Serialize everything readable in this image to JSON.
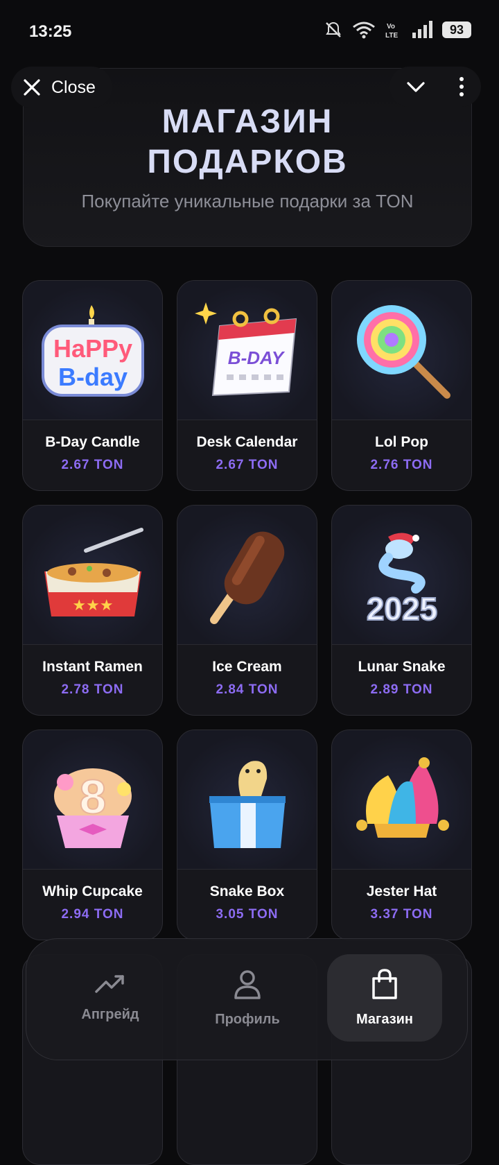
{
  "status_bar": {
    "time": "13:25",
    "battery": "93"
  },
  "top_bar": {
    "close_label": "Close"
  },
  "hero": {
    "title_line1": "МАГАЗИН",
    "title_line2": "ПОДАРКОВ",
    "subtitle": "Покупайте уникальные подарки за TON"
  },
  "gifts": [
    {
      "name": "B-Day Candle",
      "price": "2.67 TON",
      "icon": "birthday-candle-icon"
    },
    {
      "name": "Desk Calendar",
      "price": "2.67 TON",
      "icon": "desk-calendar-icon"
    },
    {
      "name": "Lol Pop",
      "price": "2.76 TON",
      "icon": "lollipop-icon"
    },
    {
      "name": "Instant Ramen",
      "price": "2.78 TON",
      "icon": "ramen-icon"
    },
    {
      "name": "Ice Cream",
      "price": "2.84 TON",
      "icon": "ice-cream-icon"
    },
    {
      "name": "Lunar Snake",
      "price": "2.89 TON",
      "icon": "lunar-snake-icon"
    },
    {
      "name": "Whip Cupcake",
      "price": "2.94 TON",
      "icon": "cupcake-icon"
    },
    {
      "name": "Snake Box",
      "price": "3.05 TON",
      "icon": "snake-box-icon"
    },
    {
      "name": "Jester Hat",
      "price": "3.37 TON",
      "icon": "jester-hat-icon"
    }
  ],
  "nav": {
    "upgrade_label": "Апгрейд",
    "profile_label": "Профиль",
    "shop_label": "Магазин",
    "active": "shop"
  },
  "colors": {
    "accent_price": "#8d6cf3",
    "hero_title": "#d8dcf5"
  }
}
